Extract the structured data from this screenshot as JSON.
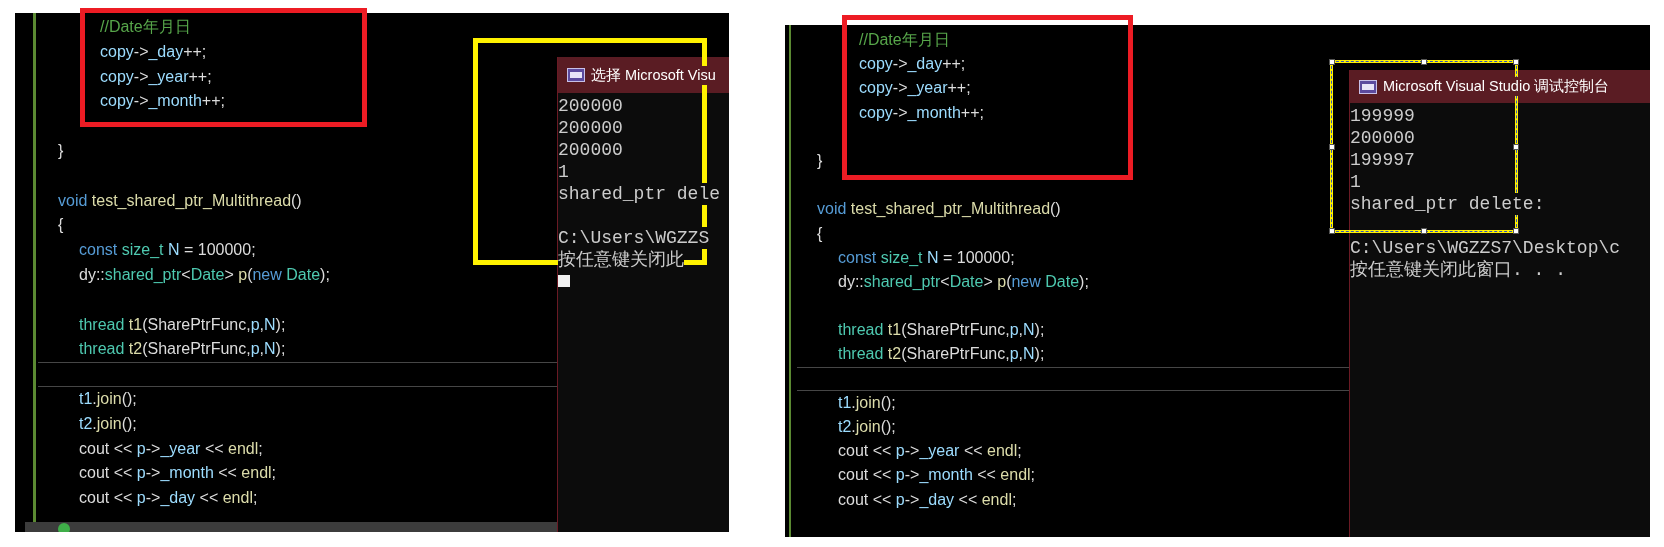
{
  "panels": [
    {
      "code_lines": [
        {
          "kind": "code",
          "tokens": [
            {
              "text": "\t\t//Date年月日",
              "kind": "comment"
            }
          ]
        },
        {
          "kind": "code",
          "tokens": [
            {
              "text": "\t\tcopy",
              "kind": "var"
            },
            {
              "text": "->",
              "kind": "plain"
            },
            {
              "text": "_day",
              "kind": "var"
            },
            {
              "text": "++;",
              "kind": "plain"
            }
          ]
        },
        {
          "kind": "code",
          "tokens": [
            {
              "text": "\t\tcopy",
              "kind": "var"
            },
            {
              "text": "->",
              "kind": "plain"
            },
            {
              "text": "_year",
              "kind": "var"
            },
            {
              "text": "++;",
              "kind": "plain"
            }
          ]
        },
        {
          "kind": "code",
          "tokens": [
            {
              "text": "\t\tcopy",
              "kind": "var"
            },
            {
              "text": "->",
              "kind": "plain"
            },
            {
              "text": "_month",
              "kind": "var"
            },
            {
              "text": "++;",
              "kind": "plain"
            }
          ]
        },
        {
          "kind": "blank"
        },
        {
          "kind": "code",
          "tokens": [
            {
              "text": "}",
              "kind": "plain"
            }
          ]
        },
        {
          "kind": "blank"
        },
        {
          "kind": "code",
          "tokens": [
            {
              "text": "void",
              "kind": "keyword"
            },
            {
              "text": " test_shared_ptr_Multithread",
              "kind": "func"
            },
            {
              "text": "()",
              "kind": "plain"
            }
          ]
        },
        {
          "kind": "code",
          "tokens": [
            {
              "text": "{",
              "kind": "plain"
            }
          ]
        },
        {
          "kind": "code",
          "tokens": [
            {
              "text": "\tconst",
              "kind": "keyword"
            },
            {
              "text": " size_t",
              "kind": "type"
            },
            {
              "text": " N",
              "kind": "var"
            },
            {
              "text": " = 100000;",
              "kind": "plain"
            }
          ]
        },
        {
          "kind": "code",
          "tokens": [
            {
              "text": "\tdy::",
              "kind": "plain"
            },
            {
              "text": "shared_ptr",
              "kind": "type"
            },
            {
              "text": "<",
              "kind": "plain"
            },
            {
              "text": "Date",
              "kind": "type"
            },
            {
              "text": "> ",
              "kind": "plain"
            },
            {
              "text": "p",
              "kind": "func"
            },
            {
              "text": "(",
              "kind": "plain"
            },
            {
              "text": "new",
              "kind": "keyword"
            },
            {
              "text": " Date",
              "kind": "type"
            },
            {
              "text": ");",
              "kind": "plain"
            }
          ]
        },
        {
          "kind": "blank"
        },
        {
          "kind": "code",
          "tokens": [
            {
              "text": "\tthread",
              "kind": "type"
            },
            {
              "text": " t1",
              "kind": "func"
            },
            {
              "text": "(SharePtrFunc,",
              "kind": "plain"
            },
            {
              "text": "p",
              "kind": "var"
            },
            {
              "text": ",",
              "kind": "plain"
            },
            {
              "text": "N",
              "kind": "var"
            },
            {
              "text": ");",
              "kind": "plain"
            }
          ]
        },
        {
          "kind": "code",
          "tokens": [
            {
              "text": "\tthread",
              "kind": "type"
            },
            {
              "text": " t2",
              "kind": "func"
            },
            {
              "text": "(SharePtrFunc,",
              "kind": "plain"
            },
            {
              "text": "p",
              "kind": "var"
            },
            {
              "text": ",",
              "kind": "plain"
            },
            {
              "text": "N",
              "kind": "var"
            },
            {
              "text": ");",
              "kind": "plain"
            }
          ]
        },
        {
          "kind": "current"
        },
        {
          "kind": "code",
          "tokens": [
            {
              "text": "\tt1",
              "kind": "var"
            },
            {
              "text": ".",
              "kind": "plain"
            },
            {
              "text": "join",
              "kind": "func"
            },
            {
              "text": "();",
              "kind": "plain"
            }
          ]
        },
        {
          "kind": "code",
          "tokens": [
            {
              "text": "\tt2",
              "kind": "var"
            },
            {
              "text": ".",
              "kind": "plain"
            },
            {
              "text": "join",
              "kind": "func"
            },
            {
              "text": "();",
              "kind": "plain"
            }
          ]
        },
        {
          "kind": "code",
          "tokens": [
            {
              "text": "\tcout << ",
              "kind": "plain"
            },
            {
              "text": "p",
              "kind": "var"
            },
            {
              "text": "->",
              "kind": "plain"
            },
            {
              "text": "_year",
              "kind": "var"
            },
            {
              "text": " << ",
              "kind": "plain"
            },
            {
              "text": "endl",
              "kind": "func"
            },
            {
              "text": ";",
              "kind": "plain"
            }
          ]
        },
        {
          "kind": "code",
          "tokens": [
            {
              "text": "\tcout << ",
              "kind": "plain"
            },
            {
              "text": "p",
              "kind": "var"
            },
            {
              "text": "->",
              "kind": "plain"
            },
            {
              "text": "_month",
              "kind": "var"
            },
            {
              "text": " << ",
              "kind": "plain"
            },
            {
              "text": "endl",
              "kind": "func"
            },
            {
              "text": ";",
              "kind": "plain"
            }
          ]
        },
        {
          "kind": "code",
          "tokens": [
            {
              "text": "\tcout << ",
              "kind": "plain"
            },
            {
              "text": "p",
              "kind": "var"
            },
            {
              "text": "->",
              "kind": "plain"
            },
            {
              "text": "_day",
              "kind": "var"
            },
            {
              "text": " << ",
              "kind": "plain"
            },
            {
              "text": "endl",
              "kind": "func"
            },
            {
              "text": ";",
              "kind": "plain"
            }
          ]
        }
      ],
      "console": {
        "title": "选择 Microsoft Visu",
        "blocks": [
          [
            "200000",
            "200000",
            "200000",
            "1",
            "shared_ptr dele"
          ],
          [
            "C:\\Users\\WGZZS",
            "按任意键关闭此"
          ]
        ],
        "cursor": true
      },
      "status_strip": true,
      "annotations": [
        {
          "color": "#ed1c24",
          "selected": false
        },
        {
          "color": "#fff200",
          "selected": false
        }
      ]
    },
    {
      "code_lines": [
        {
          "kind": "code",
          "tokens": [
            {
              "text": "\t\t//Date年月日",
              "kind": "comment"
            }
          ]
        },
        {
          "kind": "code",
          "tokens": [
            {
              "text": "\t\tcopy",
              "kind": "var"
            },
            {
              "text": "->",
              "kind": "plain"
            },
            {
              "text": "_day",
              "kind": "var"
            },
            {
              "text": "++;",
              "kind": "plain"
            }
          ]
        },
        {
          "kind": "code",
          "tokens": [
            {
              "text": "\t\tcopy",
              "kind": "var"
            },
            {
              "text": "->",
              "kind": "plain"
            },
            {
              "text": "_year",
              "kind": "var"
            },
            {
              "text": "++;",
              "kind": "plain"
            }
          ]
        },
        {
          "kind": "code",
          "tokens": [
            {
              "text": "\t\tcopy",
              "kind": "var"
            },
            {
              "text": "->",
              "kind": "plain"
            },
            {
              "text": "_month",
              "kind": "var"
            },
            {
              "text": "++;",
              "kind": "plain"
            }
          ]
        },
        {
          "kind": "blank"
        },
        {
          "kind": "code",
          "tokens": [
            {
              "text": "}",
              "kind": "plain"
            }
          ]
        },
        {
          "kind": "blank"
        },
        {
          "kind": "code",
          "tokens": [
            {
              "text": "void",
              "kind": "keyword"
            },
            {
              "text": " test_shared_ptr_Multithread",
              "kind": "func"
            },
            {
              "text": "()",
              "kind": "plain"
            }
          ]
        },
        {
          "kind": "code",
          "tokens": [
            {
              "text": "{",
              "kind": "plain"
            }
          ]
        },
        {
          "kind": "code",
          "tokens": [
            {
              "text": "\tconst",
              "kind": "keyword"
            },
            {
              "text": " size_t",
              "kind": "type"
            },
            {
              "text": " N",
              "kind": "var"
            },
            {
              "text": " = 100000;",
              "kind": "plain"
            }
          ]
        },
        {
          "kind": "code",
          "tokens": [
            {
              "text": "\tdy::",
              "kind": "plain"
            },
            {
              "text": "shared_ptr",
              "kind": "type"
            },
            {
              "text": "<",
              "kind": "plain"
            },
            {
              "text": "Date",
              "kind": "type"
            },
            {
              "text": "> ",
              "kind": "plain"
            },
            {
              "text": "p",
              "kind": "func"
            },
            {
              "text": "(",
              "kind": "plain"
            },
            {
              "text": "new",
              "kind": "keyword"
            },
            {
              "text": " Date",
              "kind": "type"
            },
            {
              "text": ");",
              "kind": "plain"
            }
          ]
        },
        {
          "kind": "blank"
        },
        {
          "kind": "code",
          "tokens": [
            {
              "text": "\tthread",
              "kind": "type"
            },
            {
              "text": " t1",
              "kind": "func"
            },
            {
              "text": "(SharePtrFunc,",
              "kind": "plain"
            },
            {
              "text": "p",
              "kind": "var"
            },
            {
              "text": ",",
              "kind": "plain"
            },
            {
              "text": "N",
              "kind": "var"
            },
            {
              "text": ");",
              "kind": "plain"
            }
          ]
        },
        {
          "kind": "code",
          "tokens": [
            {
              "text": "\tthread",
              "kind": "type"
            },
            {
              "text": " t2",
              "kind": "func"
            },
            {
              "text": "(SharePtrFunc,",
              "kind": "plain"
            },
            {
              "text": "p",
              "kind": "var"
            },
            {
              "text": ",",
              "kind": "plain"
            },
            {
              "text": "N",
              "kind": "var"
            },
            {
              "text": ");",
              "kind": "plain"
            }
          ]
        },
        {
          "kind": "current"
        },
        {
          "kind": "code",
          "tokens": [
            {
              "text": "\tt1",
              "kind": "var"
            },
            {
              "text": ".",
              "kind": "plain"
            },
            {
              "text": "join",
              "kind": "func"
            },
            {
              "text": "();",
              "kind": "plain"
            }
          ]
        },
        {
          "kind": "code",
          "tokens": [
            {
              "text": "\tt2",
              "kind": "var"
            },
            {
              "text": ".",
              "kind": "plain"
            },
            {
              "text": "join",
              "kind": "func"
            },
            {
              "text": "();",
              "kind": "plain"
            }
          ]
        },
        {
          "kind": "code",
          "tokens": [
            {
              "text": "\tcout << ",
              "kind": "plain"
            },
            {
              "text": "p",
              "kind": "var"
            },
            {
              "text": "->",
              "kind": "plain"
            },
            {
              "text": "_year",
              "kind": "var"
            },
            {
              "text": " << ",
              "kind": "plain"
            },
            {
              "text": "endl",
              "kind": "func"
            },
            {
              "text": ";",
              "kind": "plain"
            }
          ]
        },
        {
          "kind": "code",
          "tokens": [
            {
              "text": "\tcout << ",
              "kind": "plain"
            },
            {
              "text": "p",
              "kind": "var"
            },
            {
              "text": "->",
              "kind": "plain"
            },
            {
              "text": "_month",
              "kind": "var"
            },
            {
              "text": " << ",
              "kind": "plain"
            },
            {
              "text": "endl",
              "kind": "func"
            },
            {
              "text": ";",
              "kind": "plain"
            }
          ]
        },
        {
          "kind": "code",
          "tokens": [
            {
              "text": "\tcout << ",
              "kind": "plain"
            },
            {
              "text": "p",
              "kind": "var"
            },
            {
              "text": "->",
              "kind": "plain"
            },
            {
              "text": "_day",
              "kind": "var"
            },
            {
              "text": " << ",
              "kind": "plain"
            },
            {
              "text": "endl",
              "kind": "func"
            },
            {
              "text": ";",
              "kind": "plain"
            }
          ]
        }
      ],
      "console": {
        "title": "Microsoft Visual Studio 调试控制台",
        "blocks": [
          [
            "199999",
            "200000",
            "199997",
            "1",
            "shared_ptr delete:"
          ],
          [
            "C:\\Users\\WGZZS7\\Desktop\\c",
            "按任意键关闭此窗口. . ."
          ]
        ],
        "cursor": false
      },
      "annotations": [
        {
          "color": "#ed1c24",
          "selected": false
        },
        {
          "color": "#fff200",
          "selected": true
        }
      ]
    }
  ]
}
